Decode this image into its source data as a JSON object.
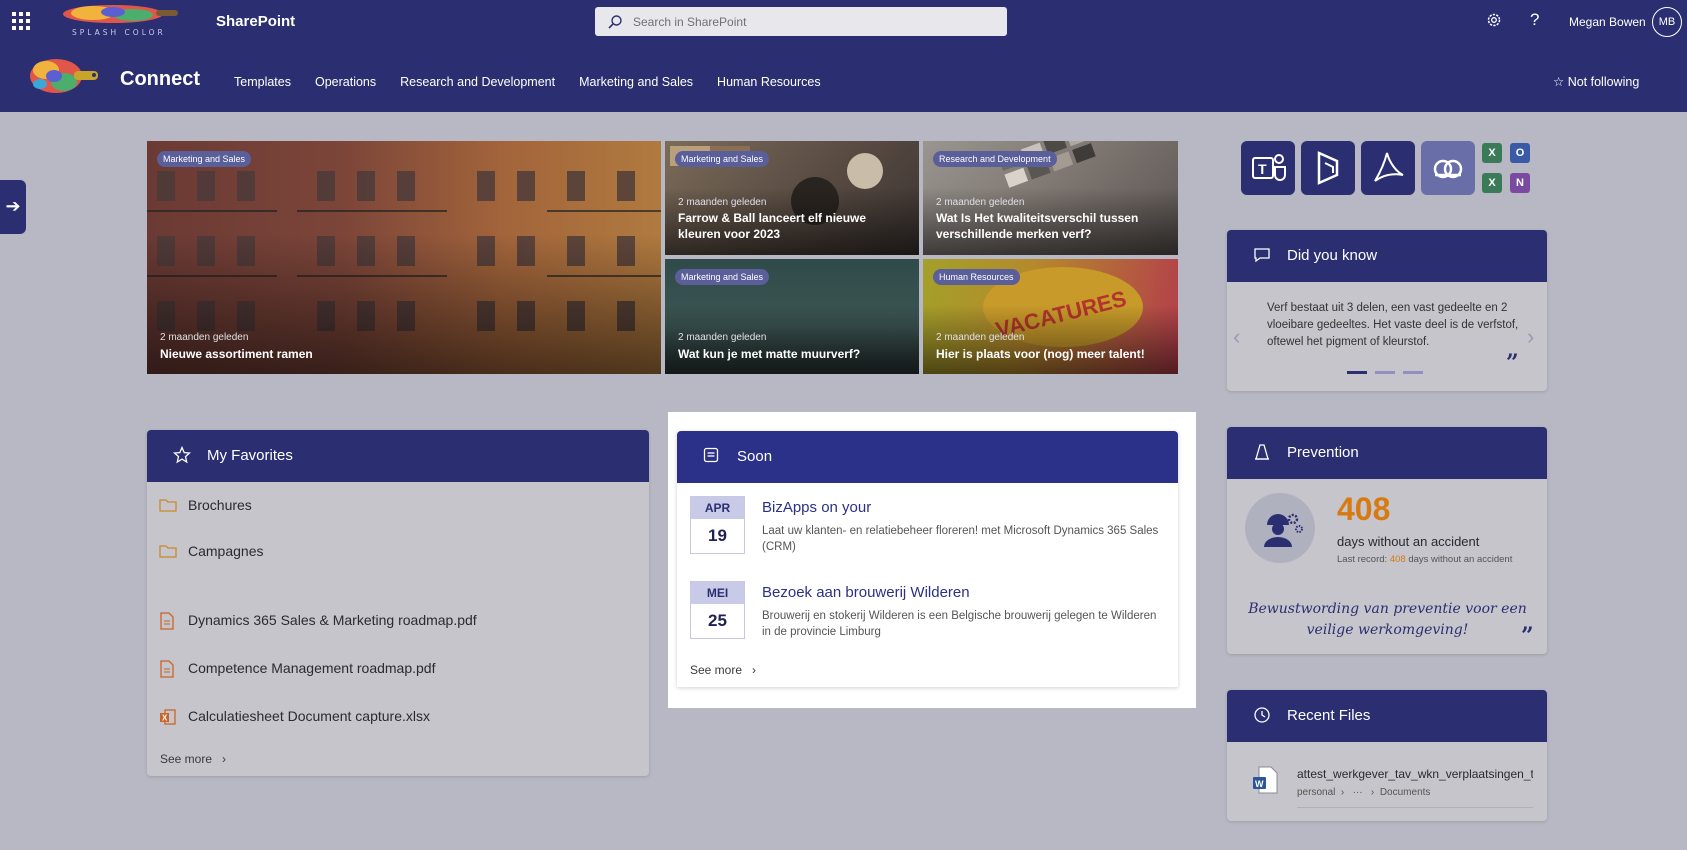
{
  "suite": {
    "logo_text": "SPLASH COLOR",
    "app_name": "SharePoint",
    "search_placeholder": "Search in SharePoint",
    "user_name": "Megan Bowen",
    "user_initials": "MB"
  },
  "site": {
    "title": "Connect",
    "nav": [
      "Templates",
      "Operations",
      "Research and Development",
      "Marketing and Sales",
      "Human Resources"
    ],
    "follow_label": "Not following"
  },
  "hero": [
    {
      "tag": "Marketing and Sales",
      "time": "2 maanden geleden",
      "title": "Nieuwe assortiment ramen"
    },
    {
      "tag": "Marketing and Sales",
      "time": "2 maanden geleden",
      "title": "Farrow & Ball lanceert elf nieuwe kleuren voor 2023"
    },
    {
      "tag": "Research and Development",
      "time": "2 maanden geleden",
      "title": "Wat Is Het kwaliteitsverschil tussen verschillende merken verf?"
    },
    {
      "tag": "Marketing and Sales",
      "time": "2 maanden geleden",
      "title": "Wat kun je met matte muurverf?"
    },
    {
      "tag": "Human Resources",
      "time": "2 maanden geleden",
      "title": "Hier is plaats voor (nog) meer talent!",
      "image_text": "VACATURES"
    }
  ],
  "favorites": {
    "title": "My Favorites",
    "items": [
      "Brochures",
      "Campagnes",
      "Dynamics 365 Sales & Marketing roadmap.pdf",
      "Competence Management roadmap.pdf",
      "Calculatiesheet Document capture.xlsx"
    ],
    "see_more": "See more"
  },
  "soon": {
    "title": "Soon",
    "events": [
      {
        "month": "APR",
        "day": "19",
        "title": "BizApps on your",
        "description": "Laat uw klanten- en relatiebeheer floreren! met Microsoft Dynamics 365 Sales (CRM)"
      },
      {
        "month": "MEI",
        "day": "25",
        "title": "Bezoek aan brouwerij Wilderen",
        "description": "Brouwerij en stokerij Wilderen is een Belgische brouwerij gelegen te Wilderen in de provincie Limburg"
      }
    ],
    "see_more": "See more"
  },
  "apps": {
    "small": [
      "X",
      "O",
      "X",
      "N"
    ]
  },
  "did_you_know": {
    "title": "Did you know",
    "text": "Verf bestaat uit 3 delen, een vast gedeelte en 2 vloeibare gedeeltes. Het vaste deel is de verfstof, oftewel het pigment of kleurstof.",
    "quote_mark": "”"
  },
  "prevention": {
    "title": "Prevention",
    "days": "408",
    "days_label": "days without an accident",
    "last_prefix": "Last record:",
    "last_value": "408",
    "last_suffix": "days without an accident",
    "quote": "Bewustwording van preventie voor een veilige werkomgeving!",
    "quote_mark": "”"
  },
  "recent_files": {
    "title": "Recent Files",
    "file_name": "attest_werkgever_tav_wkn_verplaatsingen_tj",
    "path_root": "personal",
    "path_ellipsis": "···",
    "path_leaf": "Documents",
    "file_badge": "W"
  },
  "colors": {
    "header": "#2b2f71",
    "accent_number": "#d77a12"
  }
}
